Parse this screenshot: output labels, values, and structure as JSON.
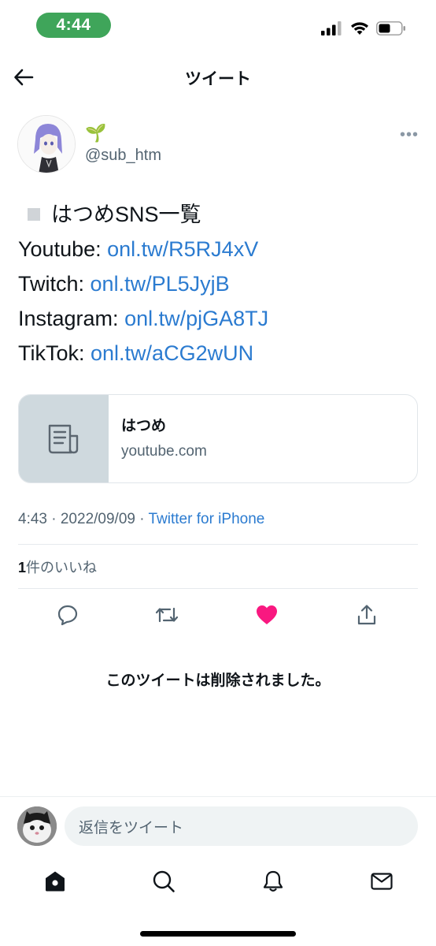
{
  "status_bar": {
    "time": "4:44"
  },
  "header": {
    "title": "ツイート"
  },
  "author": {
    "display_name": "🌱",
    "handle": "@sub_htm",
    "more": "•••"
  },
  "tweet": {
    "title": "はつめSNS一覧",
    "lines": [
      {
        "label": "Youtube: ",
        "link": "onl.tw/R5RJ4xV"
      },
      {
        "label": "Twitch: ",
        "link": "onl.tw/PL5JyjB"
      },
      {
        "label": "Instagram: ",
        "link": "onl.tw/pjGA8TJ"
      },
      {
        "label": "TikTok: ",
        "link": "onl.tw/aCG2wUN"
      }
    ]
  },
  "card": {
    "title": "はつめ",
    "domain": "youtube.com"
  },
  "meta": {
    "timestamp": "4:43 · 2022/09/09 · ",
    "source": "Twitter for iPhone"
  },
  "likes": {
    "count": "1",
    "label": "件のいいね"
  },
  "deleted_notice": "このツイートは削除されました。",
  "reply": {
    "placeholder": "返信をツイート"
  },
  "colors": {
    "accent": "#2b7bd0",
    "like": "#f91880",
    "status_pill": "#3fa55a"
  },
  "icons": [
    "back-arrow-icon",
    "more-icon",
    "article-icon",
    "reply-icon",
    "retweet-icon",
    "heart-icon",
    "share-icon",
    "home-icon",
    "search-icon",
    "notifications-icon",
    "messages-icon"
  ]
}
